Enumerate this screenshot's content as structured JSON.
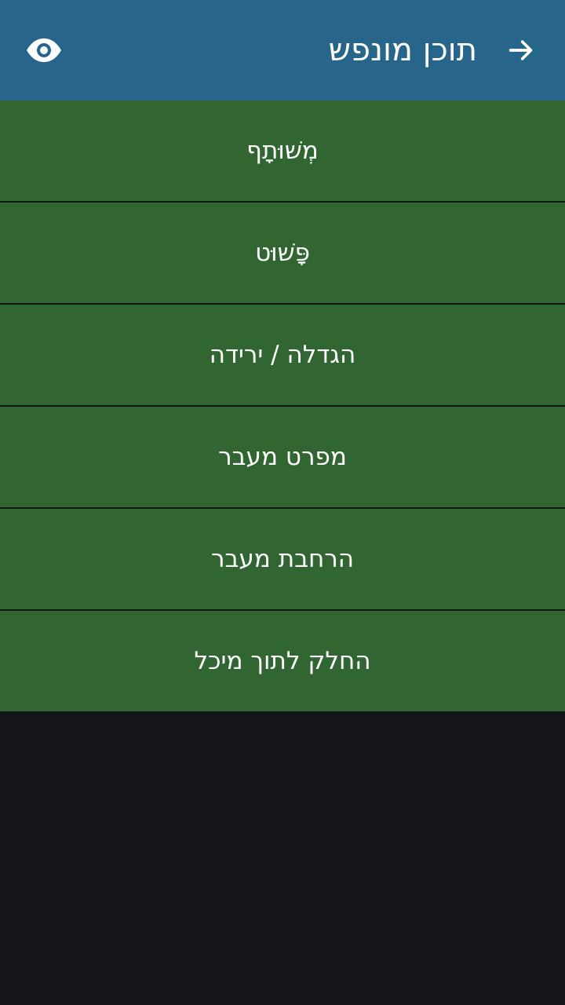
{
  "app_bar": {
    "title": "תוכן מונפש",
    "back_icon": "arrow-right-icon",
    "visibility_icon": "eye-icon",
    "background": "#27658b"
  },
  "menu": {
    "background": "#316532",
    "items": [
      {
        "label": "מְשׁוּתָף"
      },
      {
        "label": "פָּשׁוּט"
      },
      {
        "label": "הגדלה / ירידה"
      },
      {
        "label": "מפרט מעבר"
      },
      {
        "label": "הרחבת מעבר"
      },
      {
        "label": "החלק לתוך מיכל"
      }
    ]
  }
}
